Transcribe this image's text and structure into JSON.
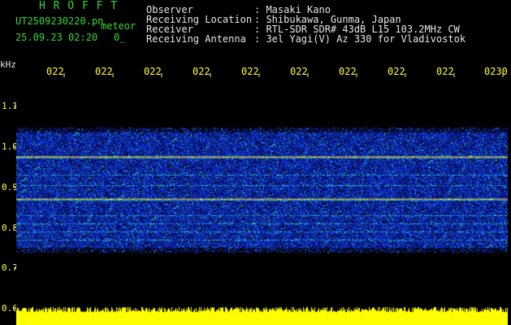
{
  "header": {
    "title": "H R O F F T",
    "filename": "UT2509230220.pn",
    "meteor": "meteor",
    "datetime": "25.09.23 02:20",
    "counter": "0_",
    "info_labels": [
      "Observer",
      "Receiving Location",
      "Receiver",
      "Receiving Antenna"
    ],
    "info_values": [
      ": Masaki Kano",
      ": Shibukawa, Gunma, Japan",
      ": RTL-SDR SDR# 43dB L15 103.2MHz CW",
      ": 3el Yagi(V) Az 330 for Vladivostok"
    ]
  },
  "axis": {
    "unit": "kHz",
    "freq_ticks": [
      "1.1",
      "1.0",
      "0.9",
      "0.8",
      "0.7",
      "0.6"
    ],
    "time_ticks": [
      "022",
      "022",
      "022",
      "022",
      "022",
      "022",
      "022",
      "022",
      "022",
      "0230"
    ]
  },
  "colors": {
    "background": "#000000",
    "spectrogram_noise": "#1a36c8",
    "carrier_line": "#ff4a3a",
    "floor_fill": "#ffff00",
    "title_green": "#36d936",
    "label_yellow": "#ffff3a"
  }
}
